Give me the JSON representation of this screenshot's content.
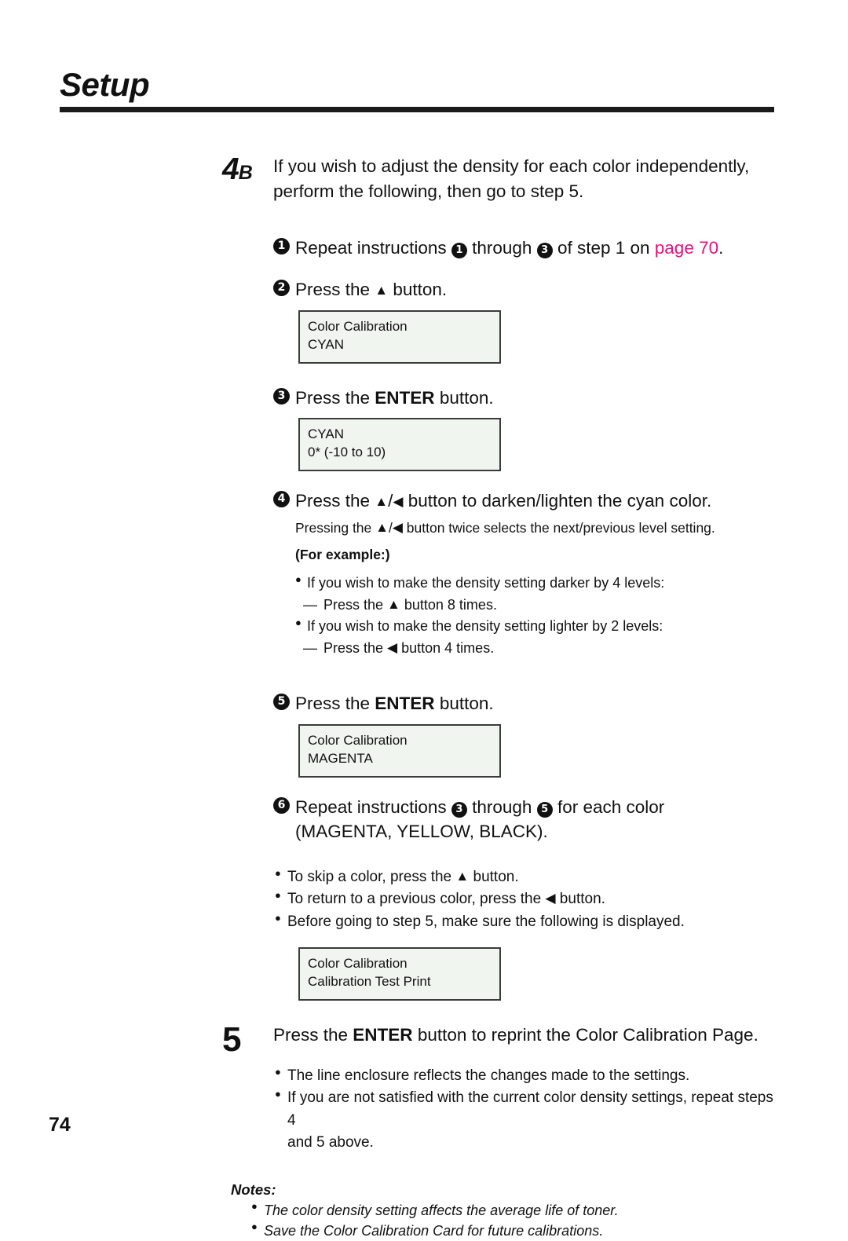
{
  "header": {
    "title": "Setup"
  },
  "step4b": {
    "number": "4",
    "letter": "B",
    "line1": "If you wish to adjust the density for each color independently,",
    "line2": "perform the following, then go to step 5."
  },
  "substeps": {
    "s1": {
      "marker": "1",
      "text_a": "Repeat instructions ",
      "ref_a": "1",
      "text_b": " through ",
      "ref_b": "3",
      "text_c": " of step 1 on ",
      "link": "page 70",
      "text_d": "."
    },
    "s2": {
      "marker": "2",
      "text_a": "Press the ",
      "icon": "▲",
      "text_b": " button."
    },
    "s3": {
      "marker": "3",
      "text_a": "Press the ",
      "bold": "ENTER",
      "text_b": " button."
    },
    "s4": {
      "marker": "4",
      "text_a": "Press the ",
      "icon_up": "▲",
      "slash": "/",
      "icon_left": "◀",
      "text_b": " button to darken/lighten the cyan color.",
      "sub_a": "Pressing the ",
      "sub_b": " button twice selects the next/previous level setting.",
      "for_example": "(For example:)"
    },
    "s5": {
      "marker": "5",
      "text_a": "Press the ",
      "bold": "ENTER",
      "text_b": " button."
    },
    "s6": {
      "marker": "6",
      "text_a": "Repeat instructions ",
      "ref_a": "3",
      "text_b": " through ",
      "ref_b": "5",
      "text_c": " for each color",
      "line2": "(MAGENTA, YELLOW, BLACK)."
    }
  },
  "lcd_cyan_title": {
    "line1": "Color Calibration",
    "line2": "CYAN"
  },
  "lcd_cyan_value": {
    "line1": "CYAN",
    "line2": "0* (-10 to 10)"
  },
  "lcd_magenta": {
    "line1": "Color Calibration",
    "line2": "MAGENTA"
  },
  "lcd_testprint": {
    "line1": "Color Calibration",
    "line2": "Calibration Test Print"
  },
  "example_bullets": {
    "b1": "If you wish to make the density setting darker by 4 levels:",
    "d1_a": "Press the ",
    "d1_icon": "▲",
    "d1_b": " button 8 times.",
    "b2": "If you wish to make the density setting lighter by 2 levels:",
    "d2_a": "Press the ",
    "d2_icon": "◀",
    "d2_b": " button 4 times.",
    "dash": "—",
    "dot": "●"
  },
  "color_bullets": {
    "b1_a": "To skip a color, press the ",
    "b1_icon": "▲",
    "b1_b": " button.",
    "b2_a": "To return to a previous color, press the ",
    "b2_icon": "◀",
    "b2_b": " button.",
    "b3": "Before going to step 5, make sure the following is displayed.",
    "dot": "●"
  },
  "step5": {
    "number": "5",
    "text_a": "Press the ",
    "bold": "ENTER",
    "text_b": " button to reprint the Color Calibration Page.",
    "b1": "The line enclosure reflects the changes made to the settings.",
    "b2": "If you are not satisfied with the current color density settings, repeat steps 4",
    "b2_cont": "and 5 above.",
    "dot": "●"
  },
  "notes": {
    "title": "Notes:",
    "items": [
      "The color density setting affects the average life of toner.",
      "Save the Color Calibration Card for future calibrations."
    ],
    "dot": "●"
  },
  "footer": {
    "page_number": "74"
  },
  "colors": {
    "link": "#ec0f7c",
    "lcd_background": "#f0f5ef",
    "lcd_border": "#3b3b3b",
    "ink": "#111111"
  }
}
